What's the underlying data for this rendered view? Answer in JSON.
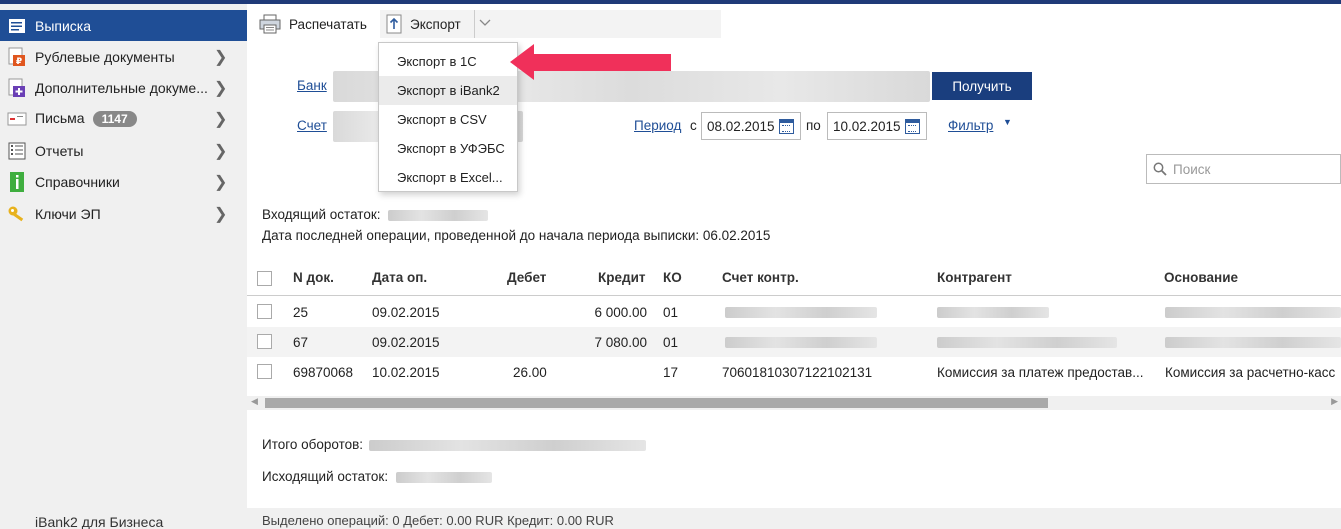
{
  "sidebar": {
    "items": [
      {
        "label": "Выписка"
      },
      {
        "label": "Рублевые документы"
      },
      {
        "label": "Дополнительные докуме..."
      },
      {
        "label": "Письма",
        "badge": "1147"
      },
      {
        "label": "Отчеты"
      },
      {
        "label": "Справочники"
      },
      {
        "label": "Ключи ЭП"
      }
    ],
    "footer": "iBank2 для Бизнеса"
  },
  "toolbar": {
    "print_label": "Распечатать",
    "export_label": "Экспорт"
  },
  "export_menu": {
    "items": [
      "Экспорт в 1С",
      "Экспорт в iBank2",
      "Экспорт в CSV",
      "Экспорт в УФЭБС",
      "Экспорт в Excel..."
    ]
  },
  "form": {
    "bank_label": "Банк",
    "account_label": "Счет",
    "get_button": "Получить",
    "period_label": "Период",
    "from_label": "с",
    "date_from": "08.02.2015",
    "to_label": "по",
    "date_to": "10.02.2015",
    "filter_label": "Фильтр",
    "search_placeholder": "Поиск"
  },
  "summary": {
    "opening_balance_label": "Входящий остаток:",
    "last_operation_text": "Дата последней операции, проведенной до начала периода выписки: 06.02.2015",
    "turnover_label": "Итого оборотов:",
    "closing_balance_label": "Исходящий остаток:"
  },
  "table": {
    "columns": [
      "N док.",
      "Дата оп.",
      "Дебет",
      "Кредит",
      "КО",
      "Счет контр.",
      "Контрагент",
      "Основание"
    ],
    "rows": [
      {
        "n": "25",
        "date": "09.02.2015",
        "debit": "",
        "credit": "6 000.00",
        "ko": "01",
        "account": "",
        "counterparty": "",
        "basis": ""
      },
      {
        "n": "67",
        "date": "09.02.2015",
        "debit": "",
        "credit": "7 080.00",
        "ko": "01",
        "account": "",
        "counterparty": "",
        "basis": ""
      },
      {
        "n": "69870068",
        "date": "10.02.2015",
        "debit": "26.00",
        "credit": "",
        "ko": "17",
        "account": "70601810307122102131",
        "counterparty": "Комиссия за платеж предостав...",
        "basis": "Комиссия за расчетно-касс"
      }
    ]
  },
  "status": {
    "text": "Выделено операций: 0 Дебет: 0.00 RUR Кредит: 0.00 RUR"
  },
  "colors": {
    "accent": "#1f4e96",
    "annotation_arrow": "#f0305a"
  }
}
